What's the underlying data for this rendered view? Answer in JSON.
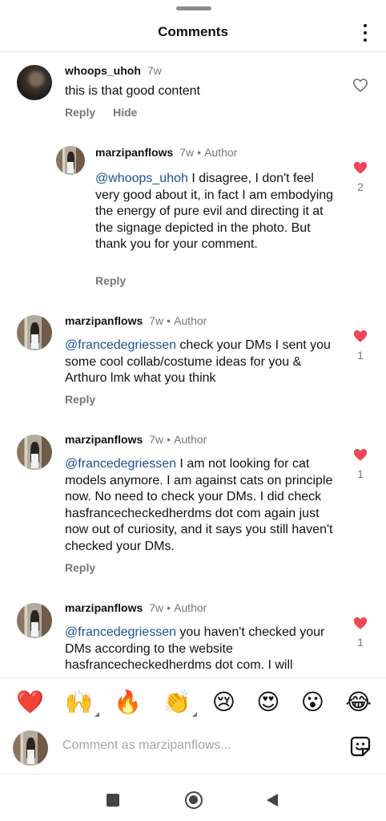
{
  "header": {
    "title": "Comments"
  },
  "comments": [
    {
      "username": "whoops_uhoh",
      "time": "7w",
      "role": "",
      "mention": "",
      "text": "this is that good content",
      "reply_label": "Reply",
      "hide_label": "Hide",
      "liked": false,
      "like_count": ""
    },
    {
      "username": "marzipanflows",
      "time": "7w",
      "role": "Author",
      "mention": "@whoops_uhoh",
      "text": " I disagree, I don't feel very good about it, in fact I am embodying the energy of pure evil and directing it at the signage depicted in the photo. But thank you for your comment.",
      "reply_label": "Reply",
      "liked": true,
      "like_count": "2"
    },
    {
      "username": "marzipanflows",
      "time": "7w",
      "role": "Author",
      "mention": "@francedegriessen",
      "text": " check your DMs I sent you some cool collab/costume ideas for you & Arthuro lmk what you think",
      "reply_label": "Reply",
      "liked": true,
      "like_count": "1"
    },
    {
      "username": "marzipanflows",
      "time": "7w",
      "role": "Author",
      "mention": "@francedegriessen",
      "text": " I am not looking for cat models anymore. I am against cats on principle now. No need to check your DMs. I did check hasfrancecheckedherdms dot com again just now out of curiosity, and it says you still haven't checked your DMs.",
      "reply_label": "Reply",
      "liked": true,
      "like_count": "1"
    },
    {
      "username": "marzipanflows",
      "time": "7w",
      "role": "Author",
      "mention": "@francedegriessen",
      "text": " you haven't checked your DMs according to the website hasfrancecheckedherdms dot com. I will",
      "reply_label": "",
      "liked": true,
      "like_count": "1"
    }
  ],
  "reactions": [
    "❤️",
    "🙌",
    "🔥",
    "👏",
    "😢",
    "😍",
    "😮",
    "😂"
  ],
  "compose": {
    "placeholder": "Comment as marzipanflows..."
  },
  "icons": {
    "heart_filled": "heart-filled-icon",
    "heart_outline": "heart-outline-icon",
    "more": "more-vertical-icon",
    "sticker": "sticker-icon"
  },
  "colors": {
    "like_red": "#ed4956",
    "mention_blue": "#1d4f91",
    "muted": "#777777"
  }
}
